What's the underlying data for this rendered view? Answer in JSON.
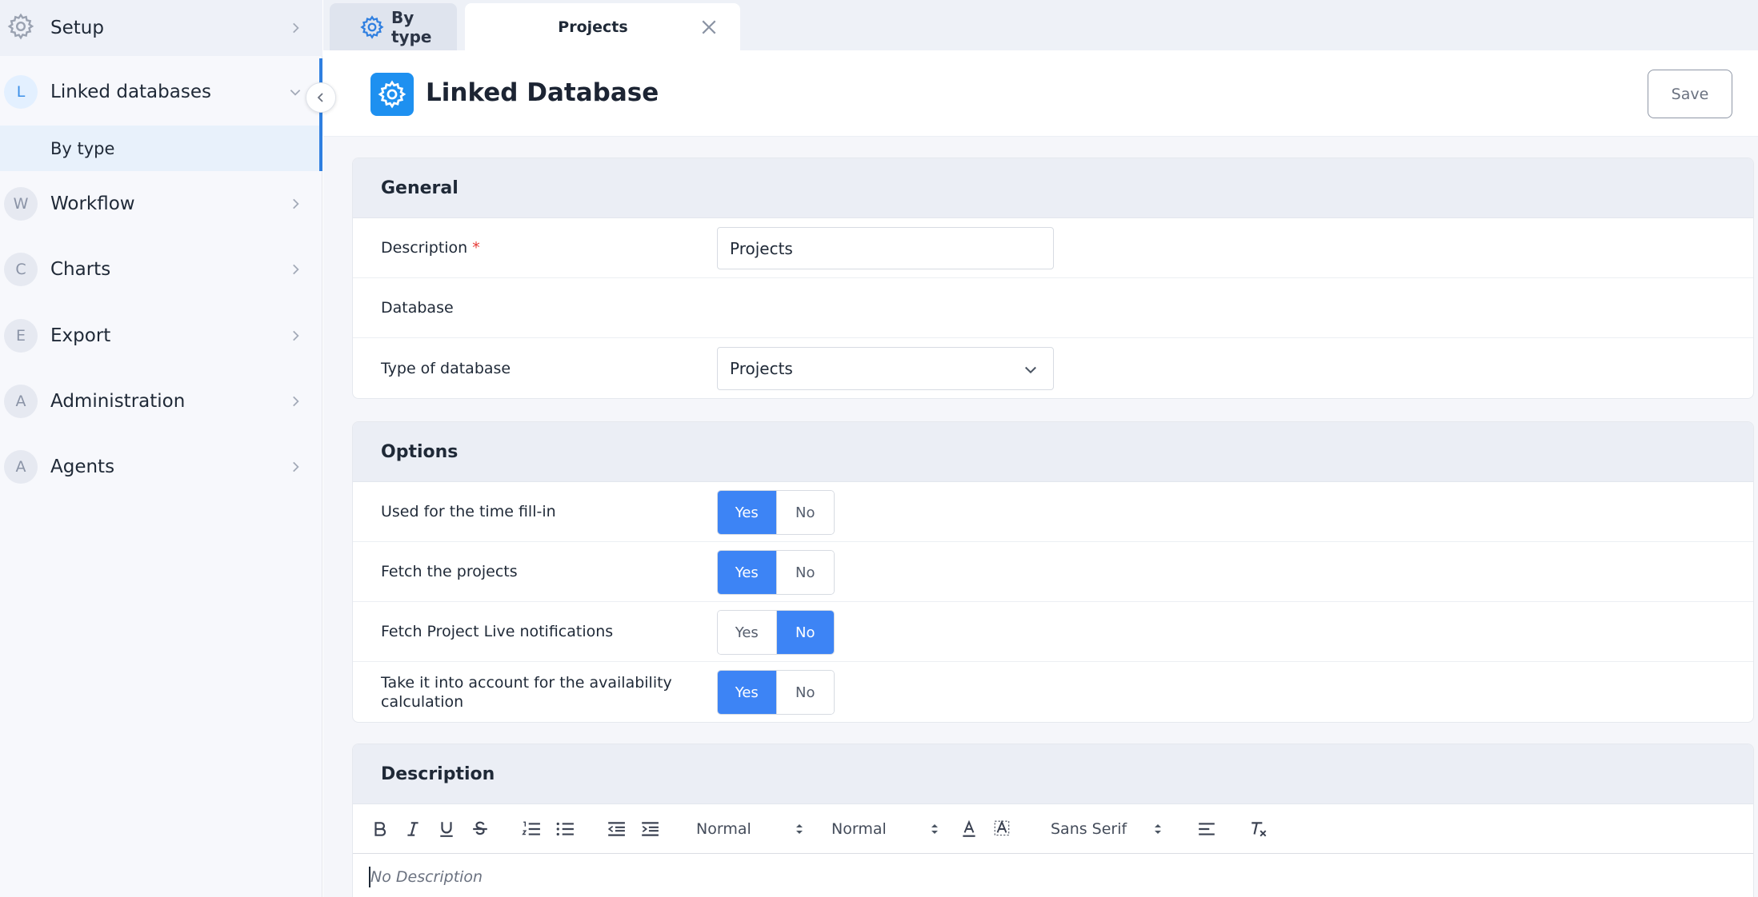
{
  "sidebar": {
    "items": [
      {
        "label": "Setup",
        "badge": ""
      },
      {
        "label": "Linked databases",
        "badge": "L"
      },
      {
        "label": "By type"
      },
      {
        "label": "Workflow",
        "badge": "W"
      },
      {
        "label": "Charts",
        "badge": "C"
      },
      {
        "label": "Export",
        "badge": "E"
      },
      {
        "label": "Administration",
        "badge": "A"
      },
      {
        "label": "Agents",
        "badge": "A"
      }
    ]
  },
  "tabs": [
    {
      "label": "By type",
      "icon": "gear-icon"
    },
    {
      "label": "Projects",
      "icon": "close-icon"
    }
  ],
  "header": {
    "title": "Linked Database",
    "save_label": "Save"
  },
  "general": {
    "title": "General",
    "description_label": "Description",
    "required_mark": "*",
    "description_value": "Projects",
    "database_label": "Database",
    "type_label": "Type of database",
    "type_value": "Projects"
  },
  "options": {
    "title": "Options",
    "yes": "Yes",
    "no": "No",
    "rows": [
      {
        "label": "Used for the time fill-in",
        "selected": "Yes"
      },
      {
        "label": "Fetch the projects",
        "selected": "Yes"
      },
      {
        "label": "Fetch Project Live notifications",
        "selected": "No"
      },
      {
        "label": "Take it into account for the availability calculation",
        "selected": "Yes"
      }
    ]
  },
  "description_section": {
    "title": "Description",
    "toolbar": {
      "size_select": "Normal",
      "header_select": "Normal",
      "font_select": "Sans Serif"
    },
    "placeholder": "No Description"
  },
  "colors": {
    "accent": "#3d84f5",
    "header_icon_bg": "#1e90f0",
    "required": "#e53935"
  }
}
